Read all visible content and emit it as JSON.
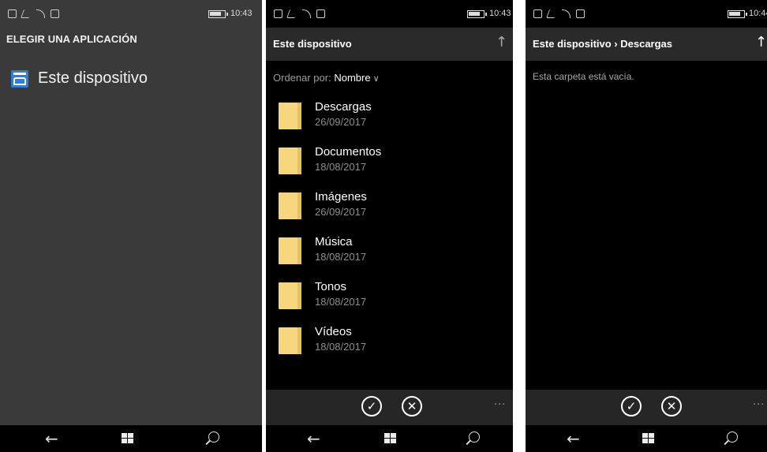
{
  "screen1": {
    "clock": "10:43",
    "title": "ELEGIR UNA APLICACIÓN",
    "device": {
      "label": "Este dispositivo",
      "icon": "folder-device-icon"
    }
  },
  "screen2": {
    "clock": "10:43",
    "header_title": "Este dispositivo",
    "up_icon": "↑",
    "sort_label": "Ordenar por:",
    "sort_value": "Nombre",
    "folders": [
      {
        "name": "Descargas",
        "date": "26/09/2017"
      },
      {
        "name": "Documentos",
        "date": "18/08/2017"
      },
      {
        "name": "Imágenes",
        "date": "26/09/2017"
      },
      {
        "name": "Música",
        "date": "18/08/2017"
      },
      {
        "name": "Tonos",
        "date": "18/08/2017"
      },
      {
        "name": "Vídeos",
        "date": "18/08/2017"
      }
    ],
    "accept_icon": "✓",
    "cancel_icon": "✕",
    "more": "···"
  },
  "screen3": {
    "clock": "10:44",
    "header_title": "Este dispositivo › Descargas",
    "up_icon": "↑",
    "empty_message": "Esta carpeta está vacía.",
    "accept_icon": "✓",
    "cancel_icon": "✕",
    "more": "···"
  },
  "navbar": {
    "back_icon": "←"
  },
  "colors": {
    "screen1_bg": "#3a3a3a",
    "device_icon": "#2f7fd8",
    "folder": "#f6d77d",
    "appbar": "#262626"
  }
}
